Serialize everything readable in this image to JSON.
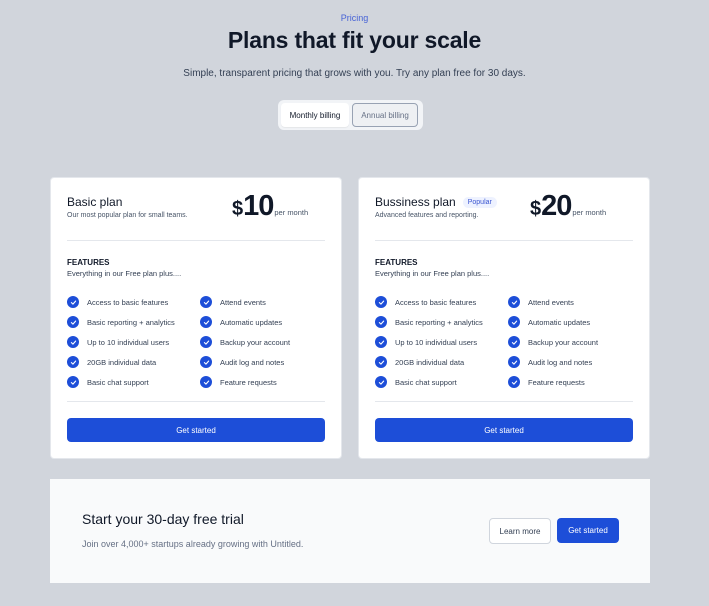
{
  "header": {
    "eyebrow": "Pricing",
    "title": "Plans that fit your scale",
    "subtitle": "Simple, transparent pricing that grows with you. Try any plan free for 30 days."
  },
  "billing_toggle": {
    "options": [
      "Monthly billing",
      "Annual billing"
    ],
    "selected": "Monthly billing"
  },
  "plans": [
    {
      "name": "Basic plan",
      "badge": "",
      "description": "Our most popular plan for small teams.",
      "currency": "$",
      "price": "10",
      "period": "per month",
      "features_title": "FEATURES",
      "features_subtitle": "Everything in our Free plan plus....",
      "features_left": [
        "Access to basic features",
        "Basic reporting + analytics",
        "Up to 10 individual users",
        "20GB individual data",
        "Basic chat support"
      ],
      "features_right": [
        "Attend events",
        "Automatic updates",
        "Backup your account",
        "Audit log and notes",
        "Feature requests"
      ],
      "cta": "Get started"
    },
    {
      "name": "Bussiness plan",
      "badge": "Popular",
      "description": "Advanced features and reporting.",
      "currency": "$",
      "price": "20",
      "period": "per month",
      "features_title": "FEATURES",
      "features_subtitle": "Everything in our Free plan plus....",
      "features_left": [
        "Access to basic features",
        "Basic reporting + analytics",
        "Up to 10 individual users",
        "20GB individual data",
        "Basic chat support"
      ],
      "features_right": [
        "Attend events",
        "Automatic updates",
        "Backup your account",
        "Audit log and notes",
        "Feature requests"
      ],
      "cta": "Get started"
    }
  ],
  "trial": {
    "title": "Start your 30-day free trial",
    "subtitle": "Join over 4,000+ startups already growing with Untitled.",
    "secondary_button": "Learn more",
    "primary_button": "Get started"
  },
  "colors": {
    "page_bg": "#d1d5dc",
    "accent": "#1d4ed8",
    "eyebrow": "#4763d6"
  }
}
